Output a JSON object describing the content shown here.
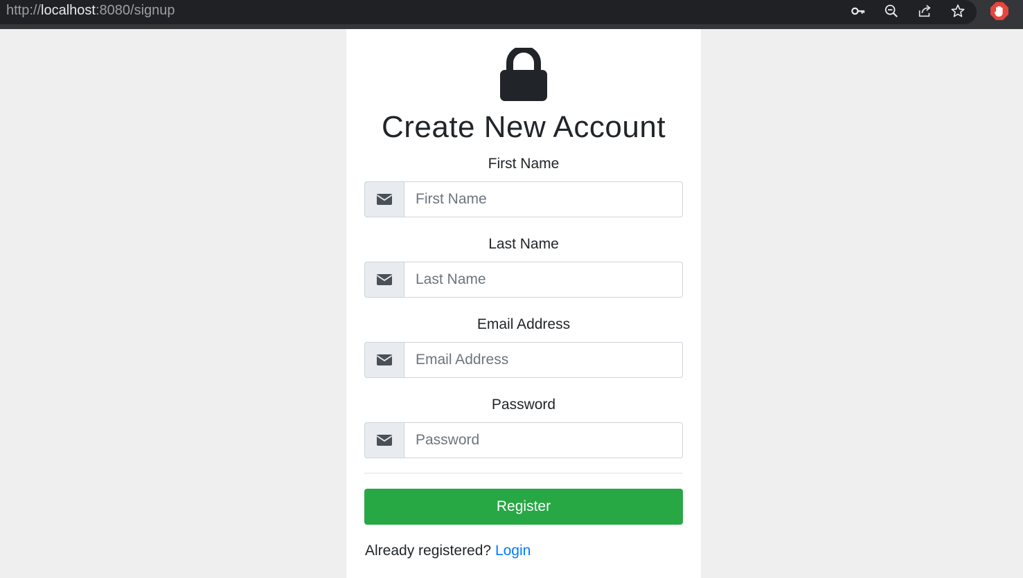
{
  "browser": {
    "url_scheme": "http://",
    "url_host": "localhost",
    "url_rest": ":8080/signup",
    "icons": [
      "key-icon",
      "zoom-out-icon",
      "share-icon",
      "star-icon",
      "extension-stop-icon"
    ]
  },
  "page": {
    "title": "Create New Account",
    "lock_icon": "lock-icon"
  },
  "form": {
    "fields": [
      {
        "label": "First Name",
        "placeholder": "First Name",
        "value": "",
        "icon": "envelope-icon"
      },
      {
        "label": "Last Name",
        "placeholder": "Last Name",
        "value": "",
        "icon": "envelope-icon"
      },
      {
        "label": "Email Address",
        "placeholder": "Email Address",
        "value": "",
        "icon": "envelope-icon"
      },
      {
        "label": "Password",
        "placeholder": "Password",
        "value": "",
        "icon": "envelope-icon"
      }
    ],
    "register_label": "Register"
  },
  "footer": {
    "prompt": "Already registered?",
    "login_label": "Login"
  },
  "colors": {
    "accent_green": "#28a745",
    "link_blue": "#007bff",
    "background": "#efefef",
    "card": "#ffffff"
  }
}
